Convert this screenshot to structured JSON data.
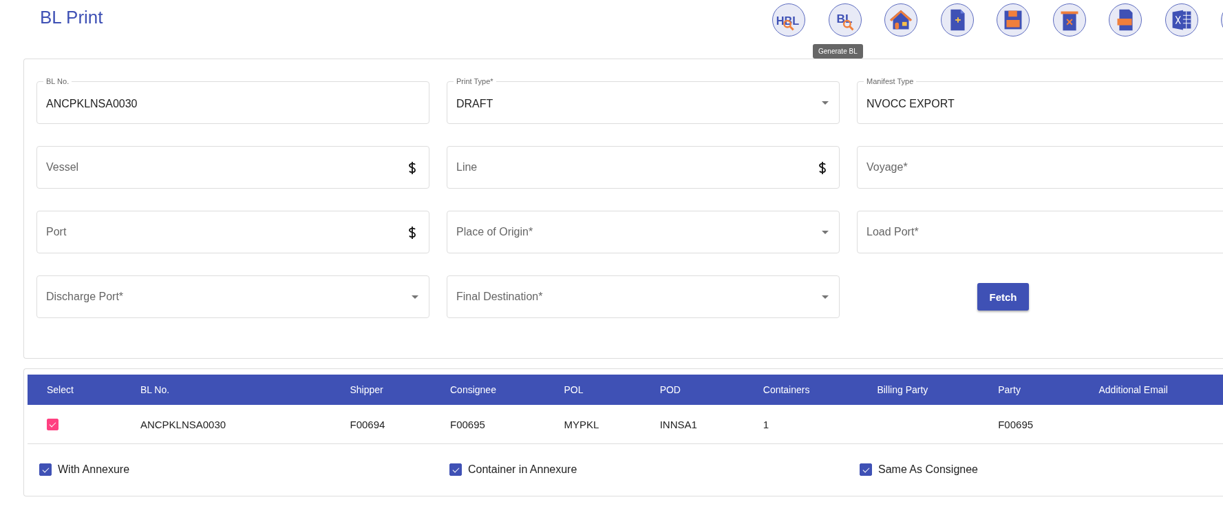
{
  "title": "BL Print",
  "toolbar": [
    {
      "kind": "hbl-search",
      "text": "HBL"
    },
    {
      "kind": "bl-search",
      "text": "BL"
    },
    {
      "kind": "home"
    },
    {
      "kind": "new"
    },
    {
      "kind": "save"
    },
    {
      "kind": "delete"
    },
    {
      "kind": "pdf"
    },
    {
      "kind": "excel"
    },
    {
      "kind": "partial"
    }
  ],
  "tooltip": "Generate BL",
  "fields": [
    {
      "label": "BL No.",
      "value": "ANCPKLNSA0030",
      "kind": "text"
    },
    {
      "label": "Print Type*",
      "value": "DRAFT",
      "kind": "select"
    },
    {
      "label": "Manifest Type",
      "value": "NVOCC EXPORT",
      "kind": "text"
    },
    {
      "placeholder": "Vessel",
      "kind": "lookup"
    },
    {
      "placeholder": "Line",
      "kind": "lookup"
    },
    {
      "placeholder": "Voyage*",
      "kind": "text"
    },
    {
      "placeholder": "Port",
      "kind": "lookup"
    },
    {
      "placeholder": "Place of Origin*",
      "kind": "select"
    },
    {
      "placeholder": "Load Port*",
      "kind": "text"
    },
    {
      "placeholder": "Discharge Port*",
      "kind": "select"
    },
    {
      "placeholder": "Final Destination*",
      "kind": "select"
    }
  ],
  "fetch_button": "Fetch",
  "table": {
    "columns": [
      "Select",
      "BL No.",
      "Shipper",
      "Consignee",
      "POL",
      "POD",
      "Containers",
      "Billing Party",
      "Party",
      "Additional Email"
    ],
    "rows": [
      {
        "selected": true,
        "cells": [
          "",
          "ANCPKLNSA0030",
          "F00694",
          "F00695",
          "MYPKL",
          "INNSA1",
          "1",
          "",
          "F00695",
          ""
        ]
      }
    ]
  },
  "options": [
    {
      "label": "With Annexure",
      "checked": true
    },
    {
      "label": "Container in Annexure",
      "checked": true
    },
    {
      "label": "Same As Consignee",
      "checked": true
    }
  ]
}
